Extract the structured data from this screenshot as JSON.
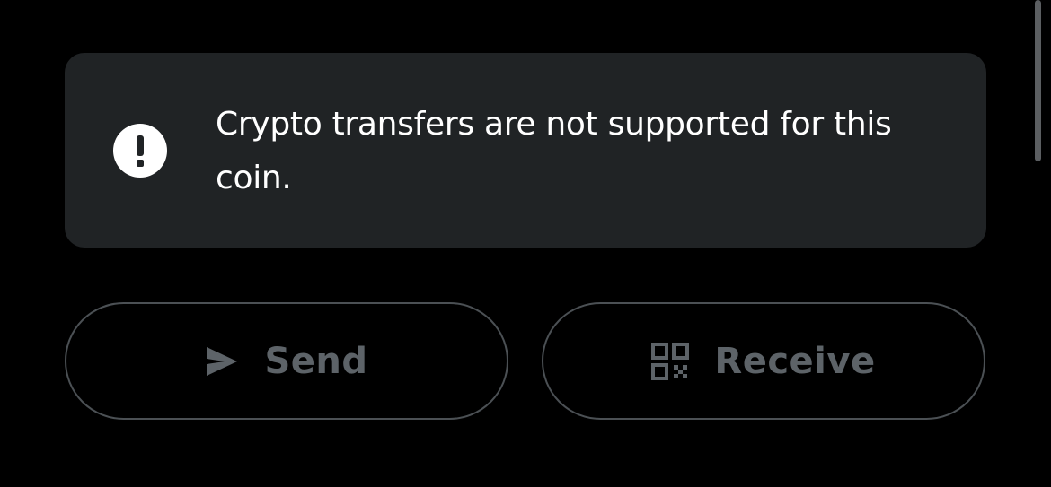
{
  "notice": {
    "icon": "exclamation-circle-icon",
    "message": "Crypto transfers are not supported for this coin."
  },
  "actions": {
    "send": {
      "label": "Send",
      "icon": "send-arrow-icon",
      "disabled": true
    },
    "receive": {
      "label": "Receive",
      "icon": "qr-code-icon",
      "disabled": true
    }
  },
  "colors": {
    "background": "#000000",
    "notice_background": "#202325",
    "notice_text": "#ffffff",
    "disabled_text": "#5d6368",
    "button_border": "#4b5054"
  }
}
